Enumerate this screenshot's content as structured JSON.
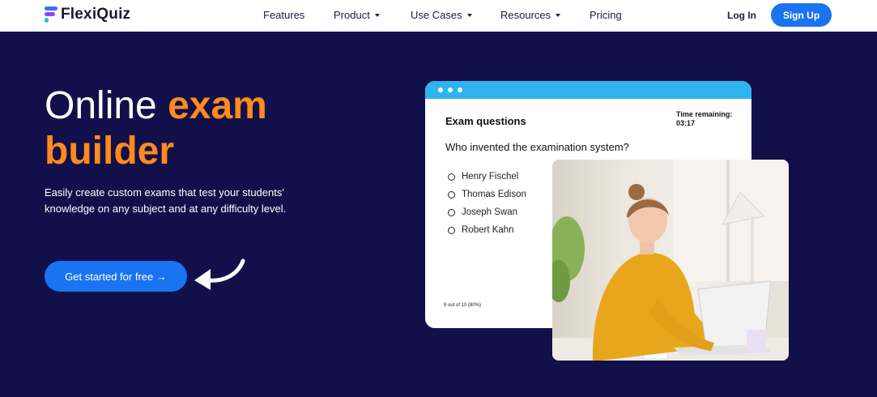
{
  "header": {
    "brand": "FlexiQuiz",
    "nav": [
      {
        "label": "Features",
        "dropdown": false
      },
      {
        "label": "Product",
        "dropdown": true
      },
      {
        "label": "Use Cases",
        "dropdown": true
      },
      {
        "label": "Resources",
        "dropdown": true
      },
      {
        "label": "Pricing",
        "dropdown": false
      }
    ],
    "login_label": "Log In",
    "signup_label": "Sign Up"
  },
  "hero": {
    "title_word1": "Online",
    "title_word2": "exam",
    "title_word3": "builder",
    "subtitle": "Easily create custom exams that test your students' knowledge on any subject and at any difficulty level.",
    "cta_label": "Get started for free →"
  },
  "quiz": {
    "heading": "Exam questions",
    "timer_label": "Time remaining:",
    "timer_value": "03:17",
    "question": "Who invented the examination system?",
    "options": [
      "Henry Fischel",
      "Thomas Edison",
      "Joseph Swan",
      "Robert Kahn"
    ],
    "score": "8 out of 10 (80%)"
  },
  "colors": {
    "background": "#11104a",
    "accent_orange": "#ff8a1f",
    "primary_blue": "#1a73f0",
    "card_bar": "#2fb4ef"
  }
}
